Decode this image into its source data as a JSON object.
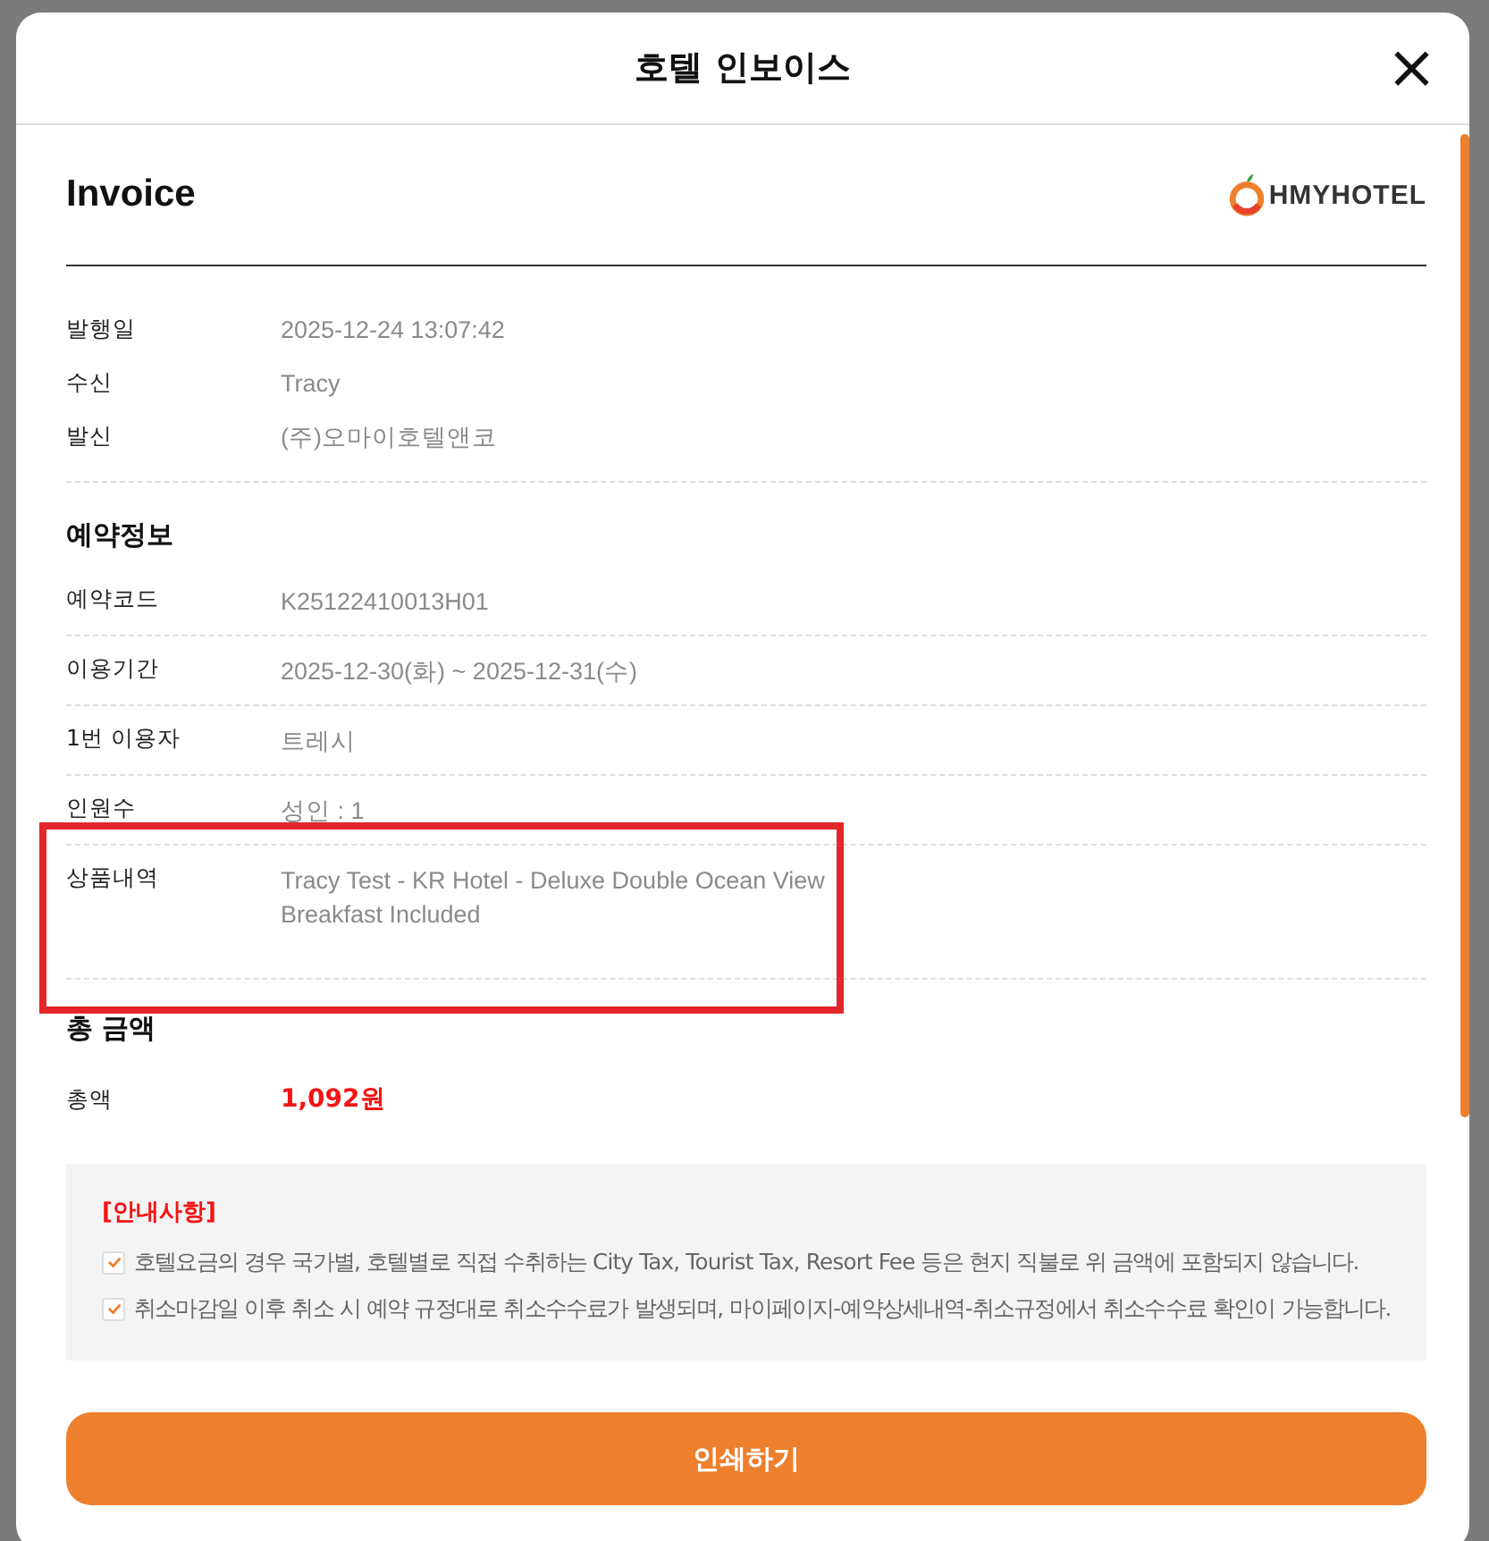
{
  "modal": {
    "title": "호텔 인보이스",
    "close": "×"
  },
  "invoice": {
    "heading": "Invoice",
    "logo_text": "HMYHOTEL"
  },
  "issue_info": [
    {
      "label": "발행일",
      "value": "2025-12-24 13:07:42"
    },
    {
      "label": "수신",
      "value": "Tracy"
    },
    {
      "label": "발신",
      "value": "(주)오마이호텔앤코"
    }
  ],
  "booking": {
    "title": "예약정보",
    "rows": [
      {
        "label": "예약코드",
        "value": "K25122410013H01",
        "highlighted": false
      },
      {
        "label": "이용기간",
        "value": "2025-12-30(화) ~ 2025-12-31(수)",
        "highlighted": false
      },
      {
        "label": "1번 이용자",
        "value": "트레시",
        "highlighted": false
      },
      {
        "label": "인원수",
        "value": "성인 : 1",
        "highlighted": false
      },
      {
        "label": "상품내역",
        "value": "Tracy Test - KR Hotel - Deluxe Double Ocean View Breakfast Included",
        "highlighted": true
      }
    ]
  },
  "total": {
    "title": "총 금액",
    "label": "총액",
    "amount": "1,092원"
  },
  "notice": {
    "title": "[안내사항]",
    "items": [
      {
        "text": "호텔요금의 경우 국가별, 호텔별로 직접 수취하는 City Tax, Tourist Tax, Resort Fee 등은 현지 직불로 위 금액에 포함되지 않습니다.",
        "checked": true
      },
      {
        "text": "취소마감일 이후 취소 시 예약 규정대로 취소수수료가 발생되며, 마이페이지-예약상세내역-취소규정에서 취소수수료 확인이 가능합니다.",
        "checked": true
      }
    ]
  },
  "print_button": "인쇄하기"
}
